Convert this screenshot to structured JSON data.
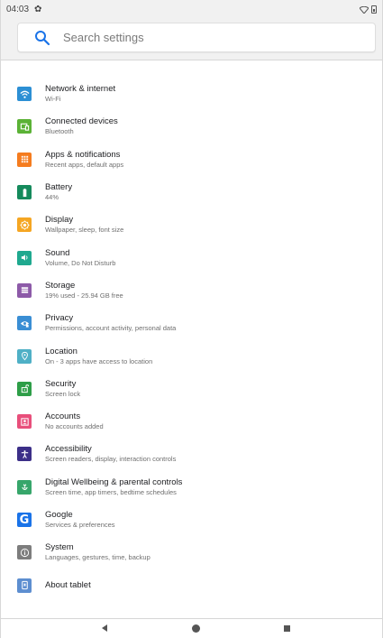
{
  "status_bar": {
    "time": "04:03"
  },
  "search": {
    "placeholder": "Search settings"
  },
  "colors": {
    "network": "#2c8fd4",
    "connected": "#5bb236",
    "apps": "#f57c1f",
    "battery": "#158a5c",
    "display": "#f5a623",
    "sound": "#1fa98f",
    "storage": "#8d5aa8",
    "privacy": "#3a8ed4",
    "location": "#4fb0c6",
    "security": "#2e9e48",
    "accounts": "#e84f7b",
    "accessibility": "#3c2f88",
    "wellbeing": "#37a66b",
    "google": "#1a73e8",
    "system": "#7d7d7d",
    "about": "#5d8ed0"
  },
  "items": [
    {
      "title": "Network & internet",
      "sub": "Wi-Fi",
      "icon": "wifi-icon"
    },
    {
      "title": "Connected devices",
      "sub": "Bluetooth",
      "icon": "devices-icon"
    },
    {
      "title": "Apps & notifications",
      "sub": "Recent apps, default apps",
      "icon": "apps-grid-icon"
    },
    {
      "title": "Battery",
      "sub": "44%",
      "icon": "battery-icon"
    },
    {
      "title": "Display",
      "sub": "Wallpaper, sleep, font size",
      "icon": "brightness-icon"
    },
    {
      "title": "Sound",
      "sub": "Volume, Do Not Disturb",
      "icon": "volume-icon"
    },
    {
      "title": "Storage",
      "sub": "19% used - 25.94 GB free",
      "icon": "storage-icon"
    },
    {
      "title": "Privacy",
      "sub": "Permissions, account activity, personal data",
      "icon": "privacy-eye-icon"
    },
    {
      "title": "Location",
      "sub": "On - 3 apps have access to location",
      "icon": "location-pin-icon"
    },
    {
      "title": "Security",
      "sub": "Screen lock",
      "icon": "lock-icon"
    },
    {
      "title": "Accounts",
      "sub": "No accounts added",
      "icon": "account-icon"
    },
    {
      "title": "Accessibility",
      "sub": "Screen readers, display, interaction controls",
      "icon": "accessibility-icon"
    },
    {
      "title": "Digital Wellbeing & parental controls",
      "sub": "Screen time, app timers, bedtime schedules",
      "icon": "wellbeing-icon"
    },
    {
      "title": "Google",
      "sub": "Services & preferences",
      "icon": "google-icon"
    },
    {
      "title": "System",
      "sub": "Languages, gestures, time, backup",
      "icon": "info-icon"
    },
    {
      "title": "About tablet",
      "sub": "",
      "icon": "tablet-icon"
    }
  ]
}
